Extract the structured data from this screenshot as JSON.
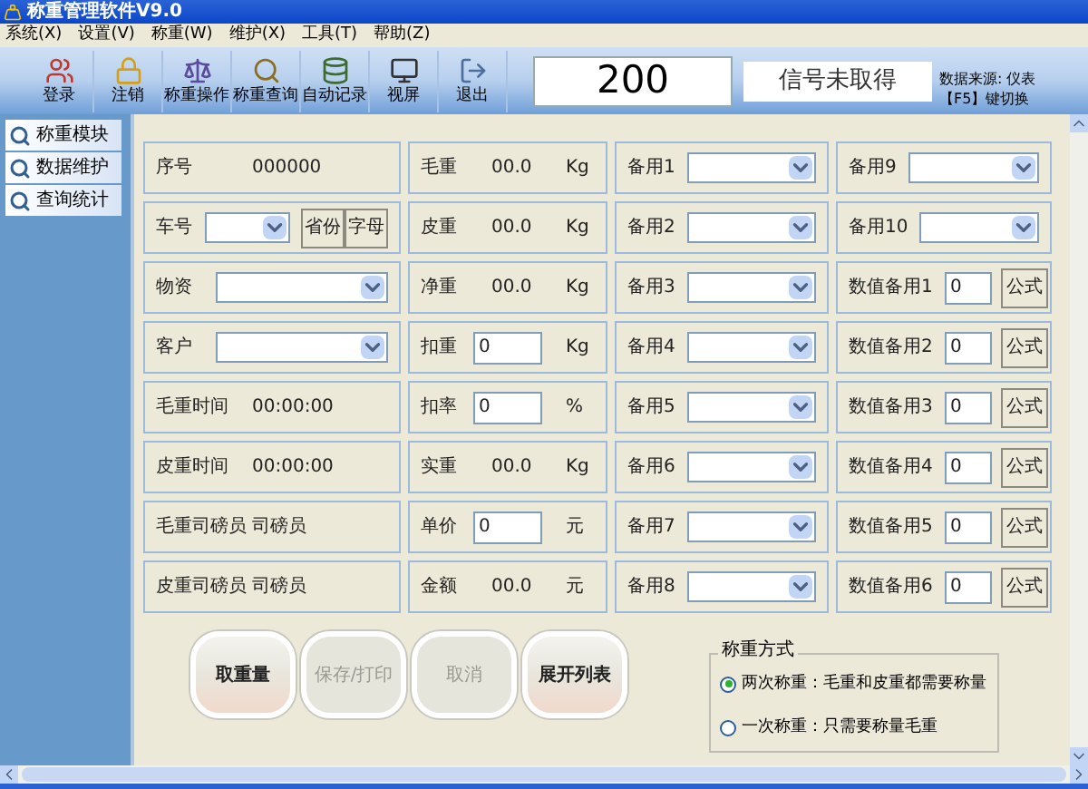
{
  "window": {
    "title": "称重管理软件V9.0"
  },
  "menu": [
    "系统(X)",
    "设置(V)",
    "称重(W)",
    "维护(X)",
    "工具(T)",
    "帮助(Z)"
  ],
  "toolbar": [
    {
      "kind": "login",
      "label": "登录"
    },
    {
      "kind": "logout",
      "label": "注销"
    },
    {
      "kind": "weigh",
      "label": "称重操作"
    },
    {
      "kind": "query",
      "label": "称重查询"
    },
    {
      "kind": "record",
      "label": "自动记录"
    },
    {
      "kind": "screen",
      "label": "视屏"
    },
    {
      "kind": "exit",
      "label": "退出"
    }
  ],
  "display": {
    "weight": "200",
    "signal": "信号未取得",
    "source": "数据来源: 仪表",
    "hint": "【F5】键切换"
  },
  "sidebar": [
    "称重模块",
    "数据维护",
    "查询统计"
  ],
  "columns": [
    [
      {
        "kind": "value",
        "label": "序号",
        "value": "000000"
      },
      {
        "kind": "plate",
        "label": "车号",
        "buttons": [
          "省份",
          "字母"
        ]
      },
      {
        "kind": "combo",
        "label": "物资"
      },
      {
        "kind": "combo",
        "label": "客户"
      },
      {
        "kind": "value",
        "label": "毛重时间",
        "value": "00:00:00"
      },
      {
        "kind": "value",
        "label": "皮重时间",
        "value": "00:00:00"
      },
      {
        "kind": "value",
        "label": "毛重司磅员",
        "value": "司磅员"
      },
      {
        "kind": "value",
        "label": "皮重司磅员",
        "value": "司磅员"
      }
    ],
    [
      {
        "kind": "value",
        "label": "毛重",
        "value": "00.0",
        "unit": "Kg"
      },
      {
        "kind": "value",
        "label": "皮重",
        "value": "00.0",
        "unit": "Kg"
      },
      {
        "kind": "value",
        "label": "净重",
        "value": "00.0",
        "unit": "Kg"
      },
      {
        "kind": "input",
        "label": "扣重",
        "value": "0",
        "unit": "Kg"
      },
      {
        "kind": "input",
        "label": "扣率",
        "value": "0",
        "unit": "%"
      },
      {
        "kind": "value",
        "label": "实重",
        "value": "00.0",
        "unit": "Kg"
      },
      {
        "kind": "input",
        "label": "单价",
        "value": "0",
        "unit": "元"
      },
      {
        "kind": "value",
        "label": "金额",
        "value": "00.0",
        "unit": "元"
      }
    ],
    [
      {
        "kind": "combo",
        "label": "备用1"
      },
      {
        "kind": "combo",
        "label": "备用2"
      },
      {
        "kind": "combo",
        "label": "备用3"
      },
      {
        "kind": "combo",
        "label": "备用4"
      },
      {
        "kind": "combo",
        "label": "备用5"
      },
      {
        "kind": "combo",
        "label": "备用6"
      },
      {
        "kind": "combo",
        "label": "备用7"
      },
      {
        "kind": "combo",
        "label": "备用8"
      }
    ],
    [
      {
        "kind": "combo",
        "label": "备用9"
      },
      {
        "kind": "combo",
        "label": "备用10"
      },
      {
        "kind": "formula",
        "label": "数值备用1",
        "value": "0",
        "button": "公式"
      },
      {
        "kind": "formula",
        "label": "数值备用2",
        "value": "0",
        "button": "公式"
      },
      {
        "kind": "formula",
        "label": "数值备用3",
        "value": "0",
        "button": "公式"
      },
      {
        "kind": "formula",
        "label": "数值备用4",
        "value": "0",
        "button": "公式"
      },
      {
        "kind": "formula",
        "label": "数值备用5",
        "value": "0",
        "button": "公式"
      },
      {
        "kind": "formula",
        "label": "数值备用6",
        "value": "0",
        "button": "公式"
      }
    ]
  ],
  "actions": [
    {
      "label": "取重量",
      "disabled": false
    },
    {
      "label": "保存/打印",
      "disabled": true
    },
    {
      "label": "取消",
      "disabled": true
    },
    {
      "label": "展开列表",
      "disabled": false
    }
  ],
  "mode": {
    "title": "称重方式",
    "options": [
      {
        "label": "两次称重：毛重和皮重都需要称量",
        "selected": true
      },
      {
        "label": "一次称重：只需要称量毛重",
        "selected": false
      }
    ]
  }
}
